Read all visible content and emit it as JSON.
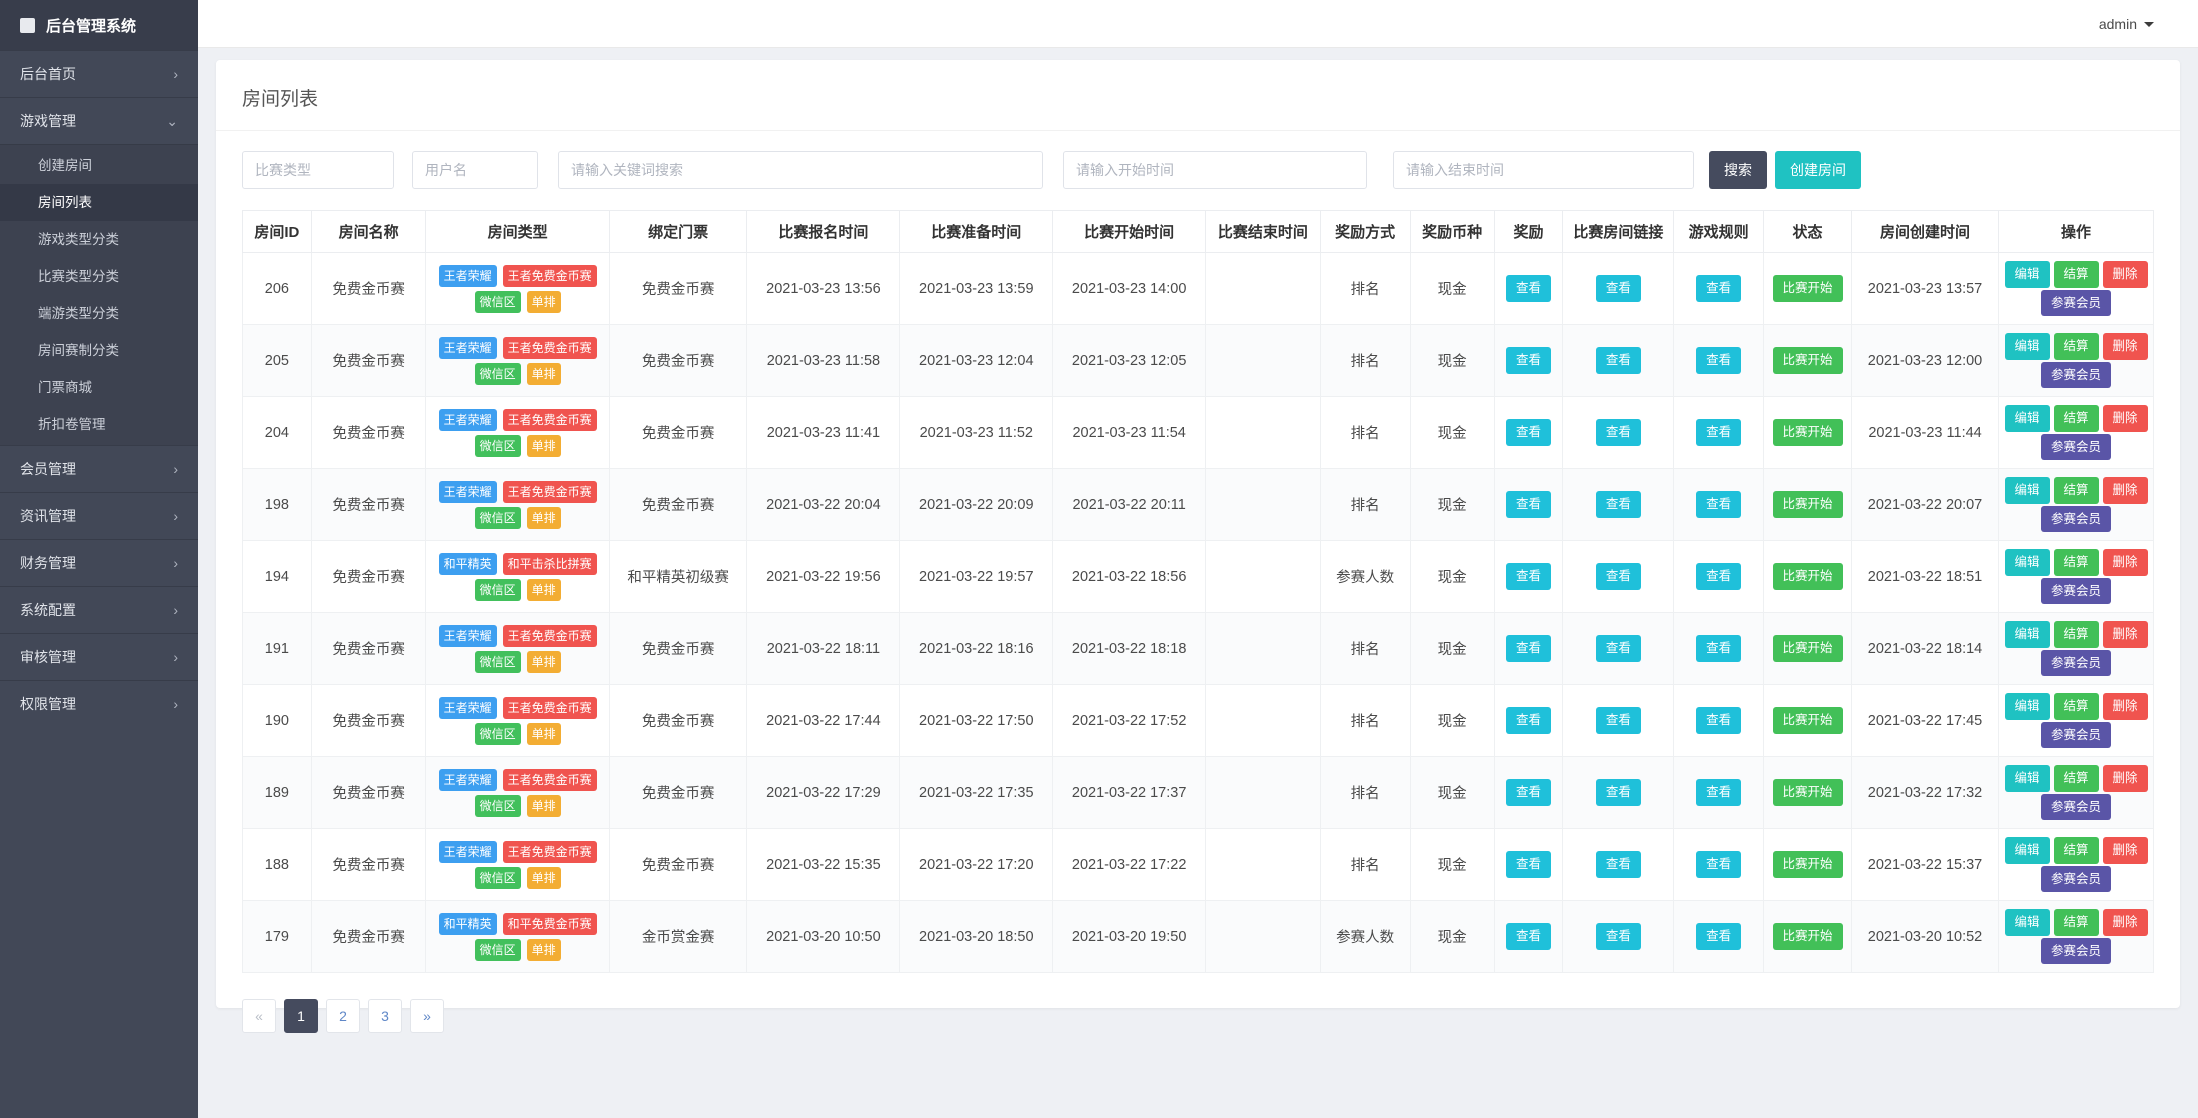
{
  "colors": {
    "sidebar_bg": "#424857",
    "sidebar_title_bg": "#383d4b",
    "accent_teal": "#1fc2c2",
    "button_dark": "#454b5e",
    "view_cyan": "#1fc0da",
    "status_green": "#42c058",
    "delete_red": "#f0544f",
    "tag_blue": "#3d9ff0",
    "tag_orange": "#f3ad33",
    "members_indigo": "#5a55a7"
  },
  "topbar": {
    "user_menu": "admin"
  },
  "sidebar": {
    "title": "后台管理系统",
    "items": [
      {
        "id": "home",
        "label": "后台首页",
        "expanded": false
      },
      {
        "id": "game-management",
        "label": "游戏管理",
        "expanded": true,
        "children": [
          {
            "id": "create-room",
            "label": "创建房间",
            "active": false
          },
          {
            "id": "room-list",
            "label": "房间列表",
            "active": true
          },
          {
            "id": "game-type-category",
            "label": "游戏类型分类",
            "active": false
          },
          {
            "id": "match-type-category",
            "label": "比赛类型分类",
            "active": false
          },
          {
            "id": "client-game-category",
            "label": "端游类型分类",
            "active": false
          },
          {
            "id": "room-format-category",
            "label": "房间赛制分类",
            "active": false
          },
          {
            "id": "ticket-mall",
            "label": "门票商城",
            "active": false
          },
          {
            "id": "discount-coupon",
            "label": "折扣卷管理",
            "active": false
          }
        ]
      },
      {
        "id": "member-management",
        "label": "会员管理",
        "expanded": false
      },
      {
        "id": "news-management",
        "label": "资讯管理",
        "expanded": false
      },
      {
        "id": "finance-management",
        "label": "财务管理",
        "expanded": false
      },
      {
        "id": "system-config",
        "label": "系统配置",
        "expanded": false
      },
      {
        "id": "audit-management",
        "label": "审核管理",
        "expanded": false
      },
      {
        "id": "permission-management",
        "label": "权限管理",
        "expanded": false
      }
    ]
  },
  "page": {
    "title": "房间列表"
  },
  "filters": {
    "match_type_placeholder": "比赛类型",
    "username_placeholder": "用户名",
    "keyword_placeholder": "请输入关键词搜索",
    "start_time_placeholder": "请输入开始时间",
    "end_time_placeholder": "请输入结束时间",
    "search_button": "搜索",
    "create_room_button": "创建房间"
  },
  "table": {
    "headers": [
      "房间ID",
      "房间名称",
      "房间类型",
      "绑定门票",
      "比赛报名时间",
      "比赛准备时间",
      "比赛开始时间",
      "比赛结束时间",
      "奖励方式",
      "奖励币种",
      "奖励",
      "比赛房间链接",
      "游戏规则",
      "状态",
      "房间创建时间",
      "操作"
    ],
    "buttons": {
      "view": "查看",
      "status": "比赛开始"
    },
    "row_actions": [
      {
        "id": "edit",
        "label": "编辑",
        "color": "teal"
      },
      {
        "id": "settle",
        "label": "结算",
        "color": "green"
      },
      {
        "id": "delete",
        "label": "删除",
        "color": "red"
      },
      {
        "id": "members",
        "label": "参赛会员",
        "color": "indigo"
      }
    ],
    "rows": [
      {
        "id": "206",
        "name": "免费金币赛",
        "tags": [
          {
            "text": "王者荣耀",
            "color": "blue"
          },
          {
            "text": "王者免费金币赛",
            "color": "red"
          },
          {
            "text": "微信区",
            "color": "green"
          },
          {
            "text": "单排",
            "color": "orange"
          }
        ],
        "ticket": "免费金币赛",
        "signup_time": "2021-03-23 13:56",
        "prepare_time": "2021-03-23 13:59",
        "start_time": "2021-03-23 14:00",
        "end_time": "",
        "reward_mode": "排名",
        "reward_currency": "现金",
        "created_time": "2021-03-23 13:57"
      },
      {
        "id": "205",
        "name": "免费金币赛",
        "tags": [
          {
            "text": "王者荣耀",
            "color": "blue"
          },
          {
            "text": "王者免费金币赛",
            "color": "red"
          },
          {
            "text": "微信区",
            "color": "green"
          },
          {
            "text": "单排",
            "color": "orange"
          }
        ],
        "ticket": "免费金币赛",
        "signup_time": "2021-03-23 11:58",
        "prepare_time": "2021-03-23 12:04",
        "start_time": "2021-03-23 12:05",
        "end_time": "",
        "reward_mode": "排名",
        "reward_currency": "现金",
        "created_time": "2021-03-23 12:00"
      },
      {
        "id": "204",
        "name": "免费金币赛",
        "tags": [
          {
            "text": "王者荣耀",
            "color": "blue"
          },
          {
            "text": "王者免费金币赛",
            "color": "red"
          },
          {
            "text": "微信区",
            "color": "green"
          },
          {
            "text": "单排",
            "color": "orange"
          }
        ],
        "ticket": "免费金币赛",
        "signup_time": "2021-03-23 11:41",
        "prepare_time": "2021-03-23 11:52",
        "start_time": "2021-03-23 11:54",
        "end_time": "",
        "reward_mode": "排名",
        "reward_currency": "现金",
        "created_time": "2021-03-23 11:44"
      },
      {
        "id": "198",
        "name": "免费金币赛",
        "tags": [
          {
            "text": "王者荣耀",
            "color": "blue"
          },
          {
            "text": "王者免费金币赛",
            "color": "red"
          },
          {
            "text": "微信区",
            "color": "green"
          },
          {
            "text": "单排",
            "color": "orange"
          }
        ],
        "ticket": "免费金币赛",
        "signup_time": "2021-03-22 20:04",
        "prepare_time": "2021-03-22 20:09",
        "start_time": "2021-03-22 20:11",
        "end_time": "",
        "reward_mode": "排名",
        "reward_currency": "现金",
        "created_time": "2021-03-22 20:07"
      },
      {
        "id": "194",
        "name": "免费金币赛",
        "tags": [
          {
            "text": "和平精英",
            "color": "blue"
          },
          {
            "text": "和平击杀比拼赛",
            "color": "red"
          },
          {
            "text": "微信区",
            "color": "green"
          },
          {
            "text": "单排",
            "color": "orange"
          }
        ],
        "ticket": "和平精英初级赛",
        "signup_time": "2021-03-22 19:56",
        "prepare_time": "2021-03-22 19:57",
        "start_time": "2021-03-22 18:56",
        "end_time": "",
        "reward_mode": "参赛人数",
        "reward_currency": "现金",
        "created_time": "2021-03-22 18:51"
      },
      {
        "id": "191",
        "name": "免费金币赛",
        "tags": [
          {
            "text": "王者荣耀",
            "color": "blue"
          },
          {
            "text": "王者免费金币赛",
            "color": "red"
          },
          {
            "text": "微信区",
            "color": "green"
          },
          {
            "text": "单排",
            "color": "orange"
          }
        ],
        "ticket": "免费金币赛",
        "signup_time": "2021-03-22 18:11",
        "prepare_time": "2021-03-22 18:16",
        "start_time": "2021-03-22 18:18",
        "end_time": "",
        "reward_mode": "排名",
        "reward_currency": "现金",
        "created_time": "2021-03-22 18:14"
      },
      {
        "id": "190",
        "name": "免费金币赛",
        "tags": [
          {
            "text": "王者荣耀",
            "color": "blue"
          },
          {
            "text": "王者免费金币赛",
            "color": "red"
          },
          {
            "text": "微信区",
            "color": "green"
          },
          {
            "text": "单排",
            "color": "orange"
          }
        ],
        "ticket": "免费金币赛",
        "signup_time": "2021-03-22 17:44",
        "prepare_time": "2021-03-22 17:50",
        "start_time": "2021-03-22 17:52",
        "end_time": "",
        "reward_mode": "排名",
        "reward_currency": "现金",
        "created_time": "2021-03-22 17:45"
      },
      {
        "id": "189",
        "name": "免费金币赛",
        "tags": [
          {
            "text": "王者荣耀",
            "color": "blue"
          },
          {
            "text": "王者免费金币赛",
            "color": "red"
          },
          {
            "text": "微信区",
            "color": "green"
          },
          {
            "text": "单排",
            "color": "orange"
          }
        ],
        "ticket": "免费金币赛",
        "signup_time": "2021-03-22 17:29",
        "prepare_time": "2021-03-22 17:35",
        "start_time": "2021-03-22 17:37",
        "end_time": "",
        "reward_mode": "排名",
        "reward_currency": "现金",
        "created_time": "2021-03-22 17:32"
      },
      {
        "id": "188",
        "name": "免费金币赛",
        "tags": [
          {
            "text": "王者荣耀",
            "color": "blue"
          },
          {
            "text": "王者免费金币赛",
            "color": "red"
          },
          {
            "text": "微信区",
            "color": "green"
          },
          {
            "text": "单排",
            "color": "orange"
          }
        ],
        "ticket": "免费金币赛",
        "signup_time": "2021-03-22 15:35",
        "prepare_time": "2021-03-22 17:20",
        "start_time": "2021-03-22 17:22",
        "end_time": "",
        "reward_mode": "排名",
        "reward_currency": "现金",
        "created_time": "2021-03-22 15:37"
      },
      {
        "id": "179",
        "name": "免费金币赛",
        "tags": [
          {
            "text": "和平精英",
            "color": "blue"
          },
          {
            "text": "和平免费金币赛",
            "color": "red"
          },
          {
            "text": "微信区",
            "color": "green"
          },
          {
            "text": "单排",
            "color": "orange"
          }
        ],
        "ticket": "金币赏金赛",
        "signup_time": "2021-03-20 10:50",
        "prepare_time": "2021-03-20 18:50",
        "start_time": "2021-03-20 19:50",
        "end_time": "",
        "reward_mode": "参赛人数",
        "reward_currency": "现金",
        "created_time": "2021-03-20 10:52"
      }
    ]
  },
  "pagination": {
    "items": [
      {
        "id": "prev",
        "label": "«",
        "muted": true
      },
      {
        "id": "page-1",
        "label": "1",
        "active": true
      },
      {
        "id": "page-2",
        "label": "2"
      },
      {
        "id": "page-3",
        "label": "3"
      },
      {
        "id": "next",
        "label": "»"
      }
    ]
  }
}
